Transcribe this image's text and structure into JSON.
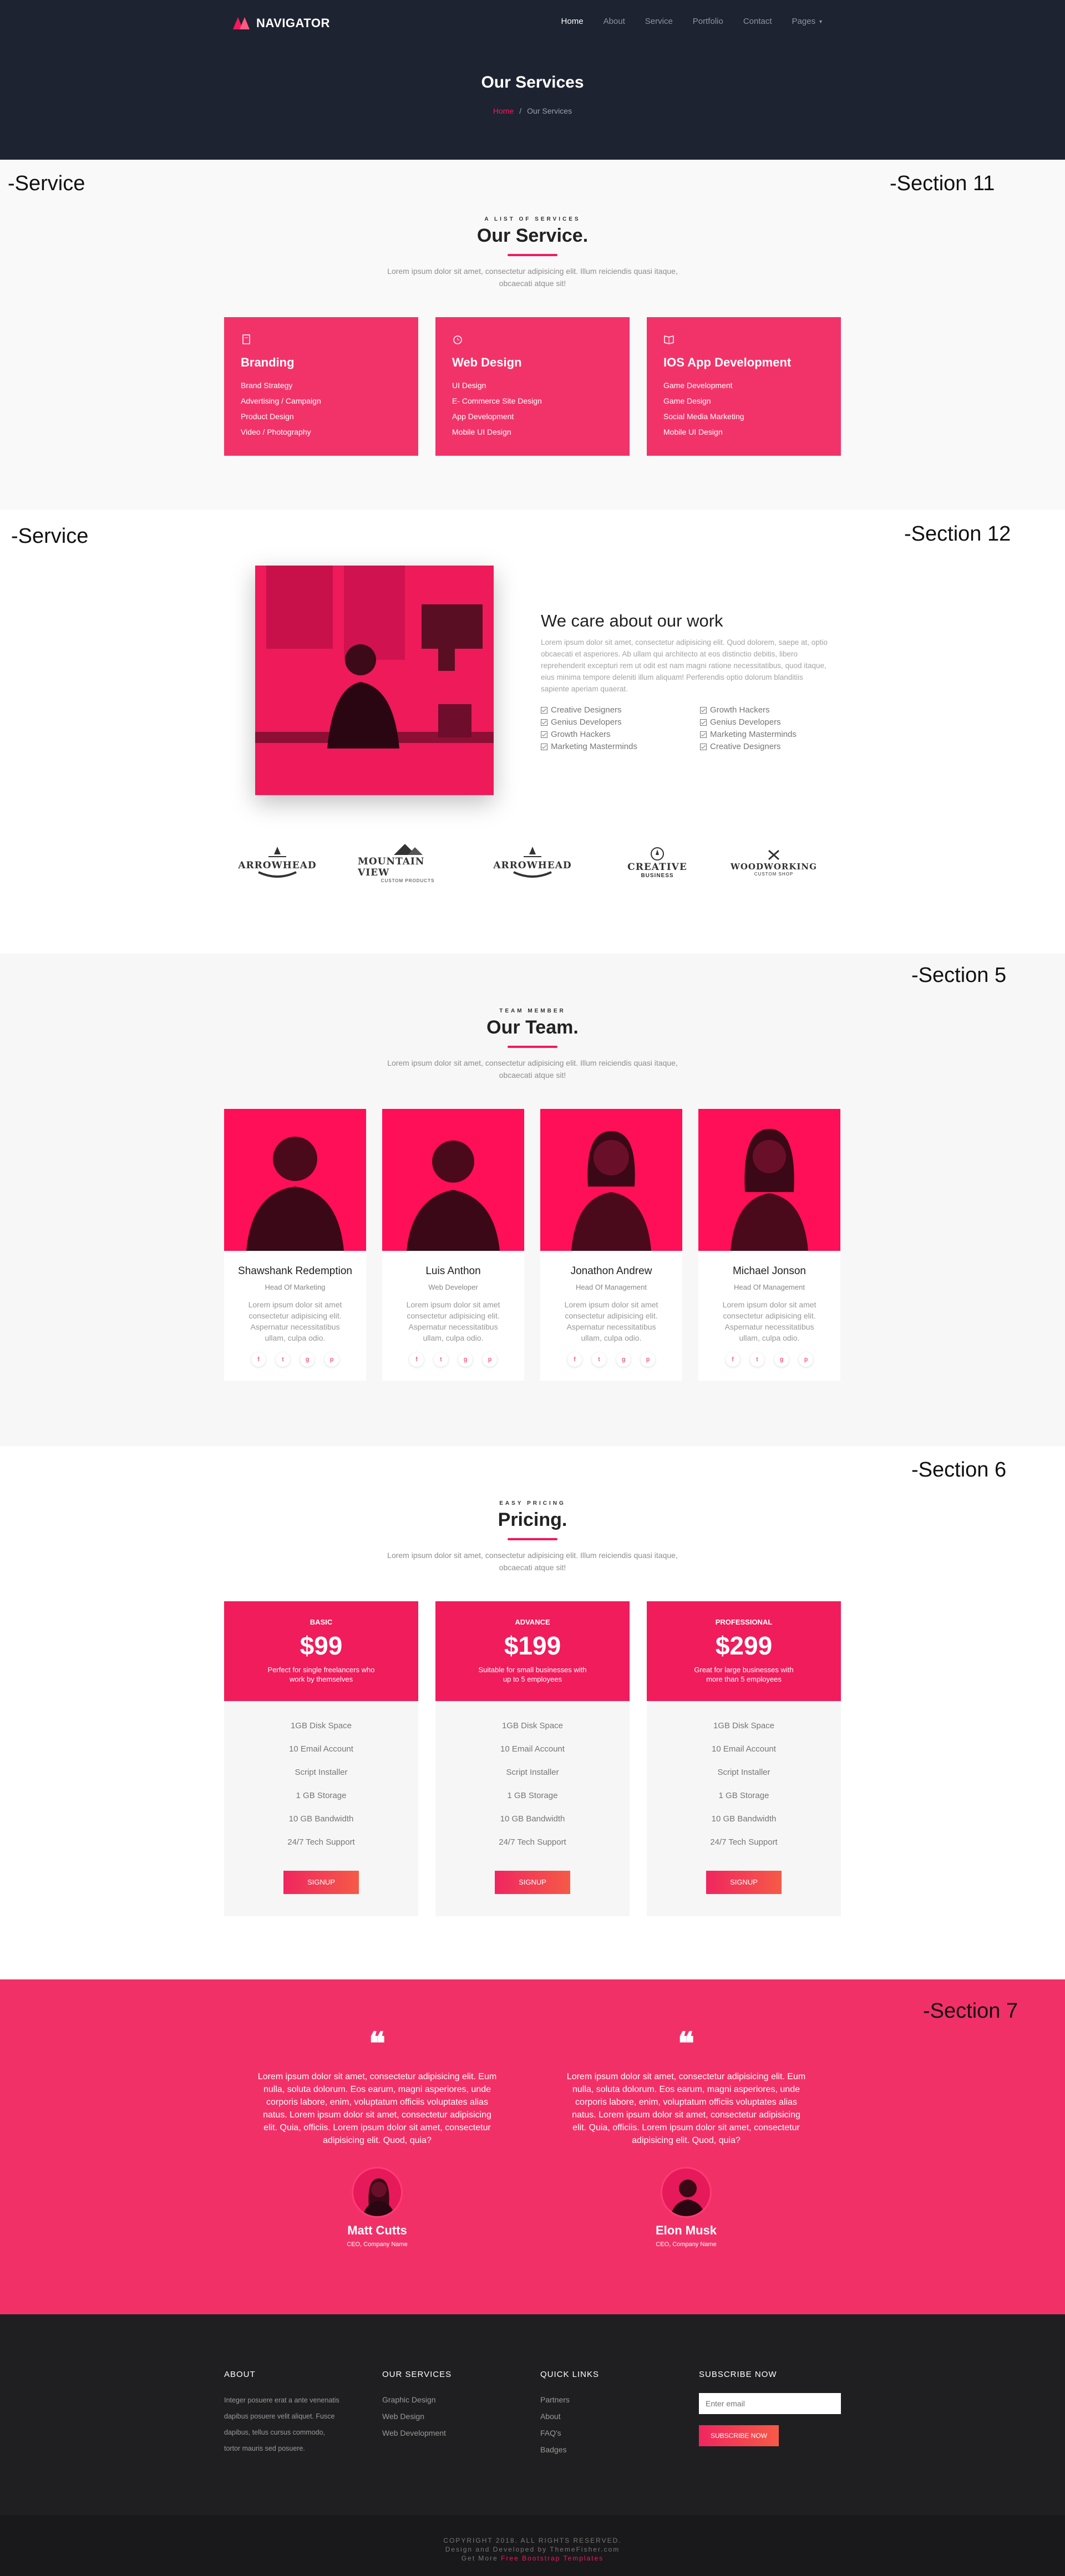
{
  "header": {
    "logo": "NAVIGATOR",
    "nav": [
      "Home",
      "About",
      "Service",
      "Portfolio",
      "Contact",
      "Pages"
    ],
    "title": "Our Services",
    "breadcrumb": {
      "home": "Home",
      "sep": "/",
      "current": "Our Services"
    }
  },
  "annotations": {
    "a1_left": "-Service",
    "a1_right": "-Section 11",
    "a2_left": "-Service",
    "a2_right": "-Section 12",
    "a3": "-Section 5",
    "a4": "-Section 6",
    "a5": "-Section 7"
  },
  "services": {
    "kicker": "A LIST OF SERVICES",
    "title": "Our Service.",
    "lead": "Lorem ipsum dolor sit amet, consectetur adipisicing elit. Illum reiciendis quasi itaque, obcaecati atque sit!",
    "cards": [
      {
        "title": "Branding",
        "items": [
          "Brand Strategy",
          "Advertising / Campaign",
          "Product Design",
          "Video / Photography"
        ]
      },
      {
        "title": "Web Design",
        "items": [
          "UI Design",
          "E- Commerce Site Design",
          "App Development",
          "Mobile UI Design"
        ]
      },
      {
        "title": "IOS App Development",
        "items": [
          "Game Development",
          "Game Design",
          "Social Media Marketing",
          "Mobile UI Design"
        ]
      }
    ]
  },
  "about": {
    "title": "We care about our work",
    "text": "Lorem ipsum dolor sit amet, consectetur adipisicing elit. Quod dolorem, saepe at, optio obcaecati et asperiores. Ab ullam qui architecto at eos distinctio debitis, libero reprehenderit excepturi rem ut odit est nam magni ratione necessitatibus, quod itaque, eius minima tempore deleniti illum aliquam! Perferendis optio dolorum blanditiis sapiente aperiam quaerat.",
    "list_left": [
      "Creative Designers",
      "Genius Developers",
      "Growth Hackers",
      "Marketing Masterminds"
    ],
    "list_right": [
      "Growth Hackers",
      "Genius Developers",
      "Marketing Masterminds",
      "Creative Designers"
    ],
    "brands": [
      "ARROWHEAD",
      "MOUNTAIN VIEW",
      "ARROWHEAD",
      "CREATIVE",
      "WOODWORKING"
    ],
    "brand_sub": [
      "",
      "CUSTOM PRODUCTS",
      "",
      "BUSINESS",
      "CUSTOM SHOP"
    ]
  },
  "team": {
    "kicker": "TEAM MEMBER",
    "title": "Our Team.",
    "lead": "Lorem ipsum dolor sit amet, consectetur adipisicing elit. Illum reiciendis quasi itaque, obcaecati atque sit!",
    "members": [
      {
        "name": "Shawshank Redemption",
        "role": "Head Of Marketing",
        "bio": "Lorem ipsum dolor sit amet consectetur adipisicing elit. Aspernatur necessitatibus ullam, culpa odio."
      },
      {
        "name": "Luis Anthon",
        "role": "Web Developer",
        "bio": "Lorem ipsum dolor sit amet consectetur adipisicing elit. Aspernatur necessitatibus ullam, culpa odio."
      },
      {
        "name": "Jonathon Andrew",
        "role": "Head Of Management",
        "bio": "Lorem ipsum dolor sit amet consectetur adipisicing elit. Aspernatur necessitatibus ullam, culpa odio."
      },
      {
        "name": "Michael Jonson",
        "role": "Head Of Management",
        "bio": "Lorem ipsum dolor sit amet consectetur adipisicing elit. Aspernatur necessitatibus ullam, culpa odio."
      }
    ],
    "social_icons": [
      "f",
      "t",
      "g",
      "p"
    ]
  },
  "pricing": {
    "kicker": "EASY PRICING",
    "title": "Pricing.",
    "lead": "Lorem ipsum dolor sit amet, consectetur adipisicing elit. Illum reiciendis quasi itaque, obcaecati atque sit!",
    "plans": [
      {
        "name": "BASIC",
        "price": "$99",
        "desc": "Perfect for single freelancers who work by themselves",
        "features": [
          "1GB Disk Space",
          "10 Email Account",
          "Script Installer",
          "1 GB Storage",
          "10 GB Bandwidth",
          "24/7 Tech Support"
        ],
        "button": "SIGNUP"
      },
      {
        "name": "ADVANCE",
        "price": "$199",
        "desc": "Suitable for small businesses with up to 5 employees",
        "features": [
          "1GB Disk Space",
          "10 Email Account",
          "Script Installer",
          "1 GB Storage",
          "10 GB Bandwidth",
          "24/7 Tech Support"
        ],
        "button": "SIGNUP"
      },
      {
        "name": "PROFESSIONAL",
        "price": "$299",
        "desc": "Great for large businesses with more than 5 employees",
        "features": [
          "1GB Disk Space",
          "10 Email Account",
          "Script Installer",
          "1 GB Storage",
          "10 GB Bandwidth",
          "24/7 Tech Support"
        ],
        "button": "SIGNUP"
      }
    ]
  },
  "testimonials": [
    {
      "quote": "Lorem ipsum dolor sit amet, consectetur adipisicing elit. Eum nulla, soluta dolorum. Eos earum, magni asperiores, unde corporis labore, enim, voluptatum officiis voluptates alias natus. Lorem ipsum dolor sit amet, consectetur adipisicing elit. Quia, officiis. Lorem ipsum dolor sit amet, consectetur adipisicing elit. Quod, quia?",
      "name": "Matt Cutts",
      "role": "CEO, Company Name"
    },
    {
      "quote": "Lorem ipsum dolor sit amet, consectetur adipisicing elit. Eum nulla, soluta dolorum. Eos earum, magni asperiores, unde corporis labore, enim, voluptatum officiis voluptates alias natus. Lorem ipsum dolor sit amet, consectetur adipisicing elit. Quia, officiis. Lorem ipsum dolor sit amet, consectetur adipisicing elit. Quod, quia?",
      "name": "Elon Musk",
      "role": "CEO, Company Name"
    }
  ],
  "footer": {
    "about_title": "ABOUT",
    "about_text": "Integer posuere erat a ante venenatis dapibus posuere velit aliquet. Fusce dapibus, tellus cursus commodo, tortor mauris sed posuere.",
    "services_title": "OUR SERVICES",
    "services": [
      "Graphic Design",
      "Web Design",
      "Web Development"
    ],
    "links_title": "QUICK LINKS",
    "links": [
      "Partners",
      "About",
      "FAQ's",
      "Badges"
    ],
    "subscribe_title": "SUBSCRIBE NOW",
    "email_placeholder": "Enter email",
    "subscribe_button": "SUBSCRIBE NOW",
    "copyright": "COPYRIGHT 2018. ALL RIGHTS RESERVED.",
    "credit": "Design and Developed by ThemeFisher.com",
    "credit2_prefix": "Get More",
    "credit2_link": "Free Bootstrap Templates"
  },
  "colors": {
    "accent": "#f5185c",
    "dark": "#1e2331",
    "footer": "#1f1f21"
  }
}
